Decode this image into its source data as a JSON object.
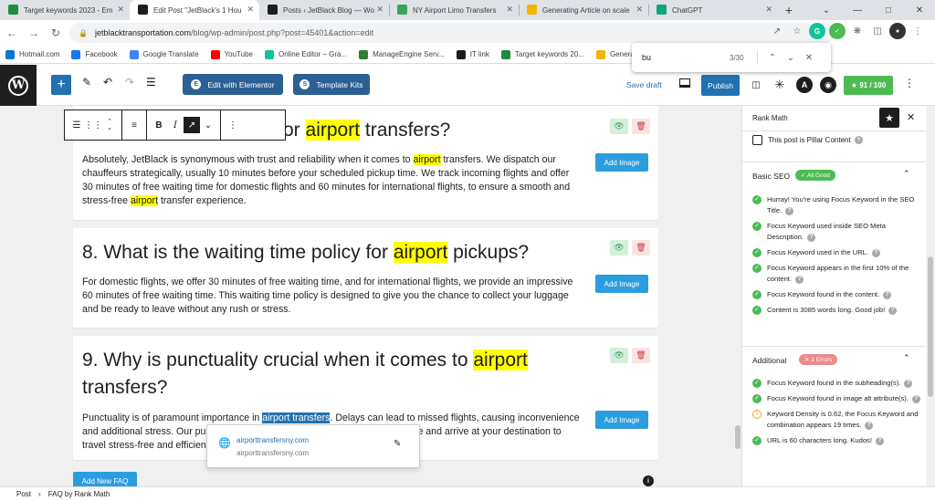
{
  "browser": {
    "tabs": [
      {
        "label": "Target keywords 2023 - Em",
        "icon": "sheets-icon",
        "color": "#1e8e3e",
        "active": false
      },
      {
        "label": "Edit Post \"JetBlack's 1 Hou",
        "icon": "wordpress-icon",
        "color": "#1e1e1e",
        "active": true
      },
      {
        "label": "Posts ‹ JetBlack Blog — Wo",
        "icon": "wordpress-icon",
        "color": "#1e1e1e",
        "active": false
      },
      {
        "label": "NY Airport Limo Transfers",
        "icon": "page-icon",
        "color": "#3aa55a",
        "active": false
      },
      {
        "label": "Generating Article on scale",
        "icon": "folder-icon",
        "color": "#f4b400",
        "active": false
      },
      {
        "label": "ChatGPT",
        "icon": "chatgpt-icon",
        "color": "#10a37f",
        "active": false
      }
    ],
    "new_tab": "+",
    "window_controls": {
      "minimize": "—",
      "maximize": "□",
      "close": "✕",
      "dropdown": "⌄"
    },
    "url_host": "jetblacktransportation.com",
    "url_path": "/blog/wp-admin/post.php?post=45401&action=edit",
    "bookmarks": [
      {
        "label": "Hotmail.com",
        "color": "#0078d4"
      },
      {
        "label": "Facebook",
        "color": "#1877f2"
      },
      {
        "label": "Google Translate",
        "color": "#4285f4"
      },
      {
        "label": "YouTube",
        "color": "#ff0000"
      },
      {
        "label": "Online Editor – Gra...",
        "color": "#15c39a"
      },
      {
        "label": "ManageEngine Serv...",
        "color": "#2e7d32"
      },
      {
        "label": "IT link",
        "color": "#1e1e1e"
      },
      {
        "label": "Target keywords 20...",
        "color": "#1e8e3e"
      },
      {
        "label": "Generating",
        "color": "#f4b400"
      }
    ],
    "find": {
      "query": "bu",
      "count": "3/30"
    }
  },
  "editor_header": {
    "elementor_label": "Edit with Elementor",
    "template_label": "Template Kits",
    "save_draft": "Save draft",
    "publish": "Publish",
    "seo_score": "91 / 100"
  },
  "faqs": [
    {
      "title_pre": "or ",
      "title_hl": "airport",
      "title_post": " transfers?",
      "answer": [
        {
          "t": "Absolutely, JetBlack is synonymous with trust and reliability when it comes to "
        },
        {
          "t": "airport",
          "hl": true
        },
        {
          "t": " transfers. We dispatch our chauffeurs strategically, usually 10 minutes before your scheduled pickup time. We track incoming flights and offer 30 minutes of free waiting time for domestic flights and 60 minutes for international flights, to ensure a smooth and stress-free "
        },
        {
          "t": "airport",
          "hl": true
        },
        {
          "t": " transfer experience."
        }
      ],
      "add_image": "Add Image"
    },
    {
      "title_pre": "8. What is the waiting time policy for ",
      "title_hl": "airport",
      "title_post": " pickups?",
      "answer": [
        {
          "t": "For domestic flights, we offer 30 minutes of free waiting time, and for international flights, we provide an impressive 60 minutes of free waiting time. This waiting time policy is designed to give you the chance to collect your luggage and be ready to leave without any rush or stress."
        }
      ],
      "add_image": "Add Image"
    },
    {
      "title_pre": "9. Why is punctuality crucial when it comes to ",
      "title_hl": "airport",
      "title_post": " transfers?",
      "answer": [
        {
          "t": "Punctuality is of paramount importance in "
        },
        {
          "t": "airport transfers",
          "sel": true
        },
        {
          "t": ". Delays can lead to missed flights, causing inconvenience and additional stress. Our punctuality ensures that you reach the airport on time and arrive at your destination to travel stress-free and efficiently."
        }
      ],
      "add_image": "Add Image"
    }
  ],
  "add_new_faq": "Add New FAQ",
  "link_popover": {
    "title": "airporttransfersny.com",
    "url": "airporttransfersny.com"
  },
  "breadcrumb": {
    "root": "Post",
    "sep": "›",
    "current": "FAQ by Rank Math"
  },
  "sidebar": {
    "title": "Rank Math",
    "pillar_label": "This post is Pillar Content",
    "basic_seo": {
      "title": "Basic SEO",
      "badge": "✓ All Good",
      "badge_color": "#4dbb54",
      "checks": [
        {
          "status": "ok",
          "text": "Hurray! You're using Focus Keyword in the SEO Title."
        },
        {
          "status": "ok",
          "text": "Focus Keyword used inside SEO Meta Description."
        },
        {
          "status": "ok",
          "text": "Focus Keyword used in the URL."
        },
        {
          "status": "ok",
          "text": "Focus Keyword appears in the first 10% of the content."
        },
        {
          "status": "ok",
          "text": "Focus Keyword found in the content."
        },
        {
          "status": "ok",
          "text": "Content is 3085 words long. Good job!"
        }
      ]
    },
    "additional": {
      "title": "Additional",
      "badge": "✕ 1 Errors",
      "badge_color": "#eb8b8b",
      "checks": [
        {
          "status": "ok",
          "text": "Focus Keyword found in the subheading(s)."
        },
        {
          "status": "ok",
          "text": "Focus Keyword found in image alt attribute(s)."
        },
        {
          "status": "warn",
          "text": "Keyword Density is 0.62, the Focus Keyword and combination appears 19 times."
        },
        {
          "status": "ok",
          "text": "URL is 60 characters long. Kudos!"
        }
      ]
    }
  }
}
